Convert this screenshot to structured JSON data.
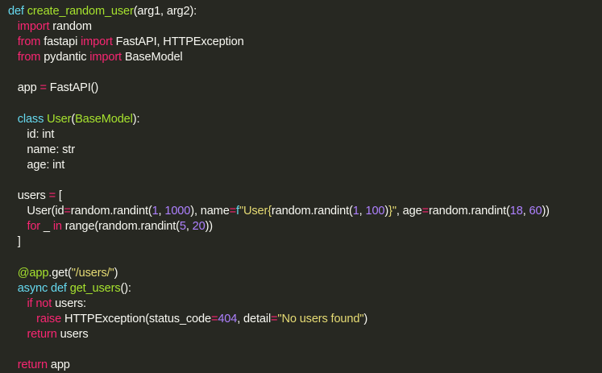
{
  "colors": {
    "background": "#272822",
    "text": "#f8f8f2",
    "keyword_pink": "#f92672",
    "keyword_blue": "#66d9ef",
    "function_green": "#a6e22e",
    "string_yellow": "#e6db74",
    "number_purple": "#ae81ff"
  },
  "code": {
    "lines": [
      [
        {
          "t": "def",
          "c": "kwd"
        },
        {
          "t": " "
        },
        {
          "t": "create_random_user",
          "c": "fn"
        },
        {
          "t": "(arg1, arg2):"
        }
      ],
      [
        {
          "t": "   "
        },
        {
          "t": "import",
          "c": "kw"
        },
        {
          "t": " random"
        }
      ],
      [
        {
          "t": "   "
        },
        {
          "t": "from",
          "c": "kw"
        },
        {
          "t": " fastapi "
        },
        {
          "t": "import",
          "c": "kw"
        },
        {
          "t": " FastAPI, HTTPException"
        }
      ],
      [
        {
          "t": "   "
        },
        {
          "t": "from",
          "c": "kw"
        },
        {
          "t": " pydantic "
        },
        {
          "t": "import",
          "c": "kw"
        },
        {
          "t": " BaseModel"
        }
      ],
      [],
      [
        {
          "t": "   app "
        },
        {
          "t": "=",
          "c": "op"
        },
        {
          "t": " FastAPI()"
        }
      ],
      [],
      [
        {
          "t": "   "
        },
        {
          "t": "class",
          "c": "kwd"
        },
        {
          "t": " "
        },
        {
          "t": "User",
          "c": "fn"
        },
        {
          "t": "("
        },
        {
          "t": "BaseModel",
          "c": "fn"
        },
        {
          "t": "):"
        }
      ],
      [
        {
          "t": "      id: int"
        }
      ],
      [
        {
          "t": "      name: str"
        }
      ],
      [
        {
          "t": "      age: int"
        }
      ],
      [],
      [
        {
          "t": "   users "
        },
        {
          "t": "=",
          "c": "op"
        },
        {
          "t": " ["
        }
      ],
      [
        {
          "t": "      User(id"
        },
        {
          "t": "=",
          "c": "op"
        },
        {
          "t": "random.randint("
        },
        {
          "t": "1",
          "c": "num"
        },
        {
          "t": ", "
        },
        {
          "t": "1000",
          "c": "num"
        },
        {
          "t": "), name"
        },
        {
          "t": "=",
          "c": "op"
        },
        {
          "t": "f",
          "c": "kwd"
        },
        {
          "t": "\"User{",
          "c": "str"
        },
        {
          "t": "random.randint("
        },
        {
          "t": "1",
          "c": "num"
        },
        {
          "t": ", "
        },
        {
          "t": "100",
          "c": "num"
        },
        {
          "t": ")"
        },
        {
          "t": "}\"",
          "c": "str"
        },
        {
          "t": ", age"
        },
        {
          "t": "=",
          "c": "op"
        },
        {
          "t": "random.randint("
        },
        {
          "t": "18",
          "c": "num"
        },
        {
          "t": ", "
        },
        {
          "t": "60",
          "c": "num"
        },
        {
          "t": "))"
        }
      ],
      [
        {
          "t": "      "
        },
        {
          "t": "for",
          "c": "kw"
        },
        {
          "t": " _ "
        },
        {
          "t": "in",
          "c": "kw"
        },
        {
          "t": " range(random.randint("
        },
        {
          "t": "5",
          "c": "num"
        },
        {
          "t": ", "
        },
        {
          "t": "20",
          "c": "num"
        },
        {
          "t": "))"
        }
      ],
      [
        {
          "t": "   ]"
        }
      ],
      [],
      [
        {
          "t": "   "
        },
        {
          "t": "@app",
          "c": "dec"
        },
        {
          "t": ".get("
        },
        {
          "t": "\"/users/\"",
          "c": "str"
        },
        {
          "t": ")"
        }
      ],
      [
        {
          "t": "   "
        },
        {
          "t": "async",
          "c": "kwd"
        },
        {
          "t": " "
        },
        {
          "t": "def",
          "c": "kwd"
        },
        {
          "t": " "
        },
        {
          "t": "get_users",
          "c": "fn"
        },
        {
          "t": "():"
        }
      ],
      [
        {
          "t": "      "
        },
        {
          "t": "if",
          "c": "kw"
        },
        {
          "t": " "
        },
        {
          "t": "not",
          "c": "kw"
        },
        {
          "t": " users:"
        }
      ],
      [
        {
          "t": "         "
        },
        {
          "t": "raise",
          "c": "kw"
        },
        {
          "t": " HTTPException(status_code"
        },
        {
          "t": "=",
          "c": "op"
        },
        {
          "t": "404",
          "c": "num"
        },
        {
          "t": ", detail"
        },
        {
          "t": "=",
          "c": "op"
        },
        {
          "t": "\"No users found\"",
          "c": "str"
        },
        {
          "t": ")"
        }
      ],
      [
        {
          "t": "      "
        },
        {
          "t": "return",
          "c": "kw"
        },
        {
          "t": " users"
        }
      ],
      [],
      [
        {
          "t": "   "
        },
        {
          "t": "return",
          "c": "kw"
        },
        {
          "t": " app"
        }
      ]
    ]
  }
}
